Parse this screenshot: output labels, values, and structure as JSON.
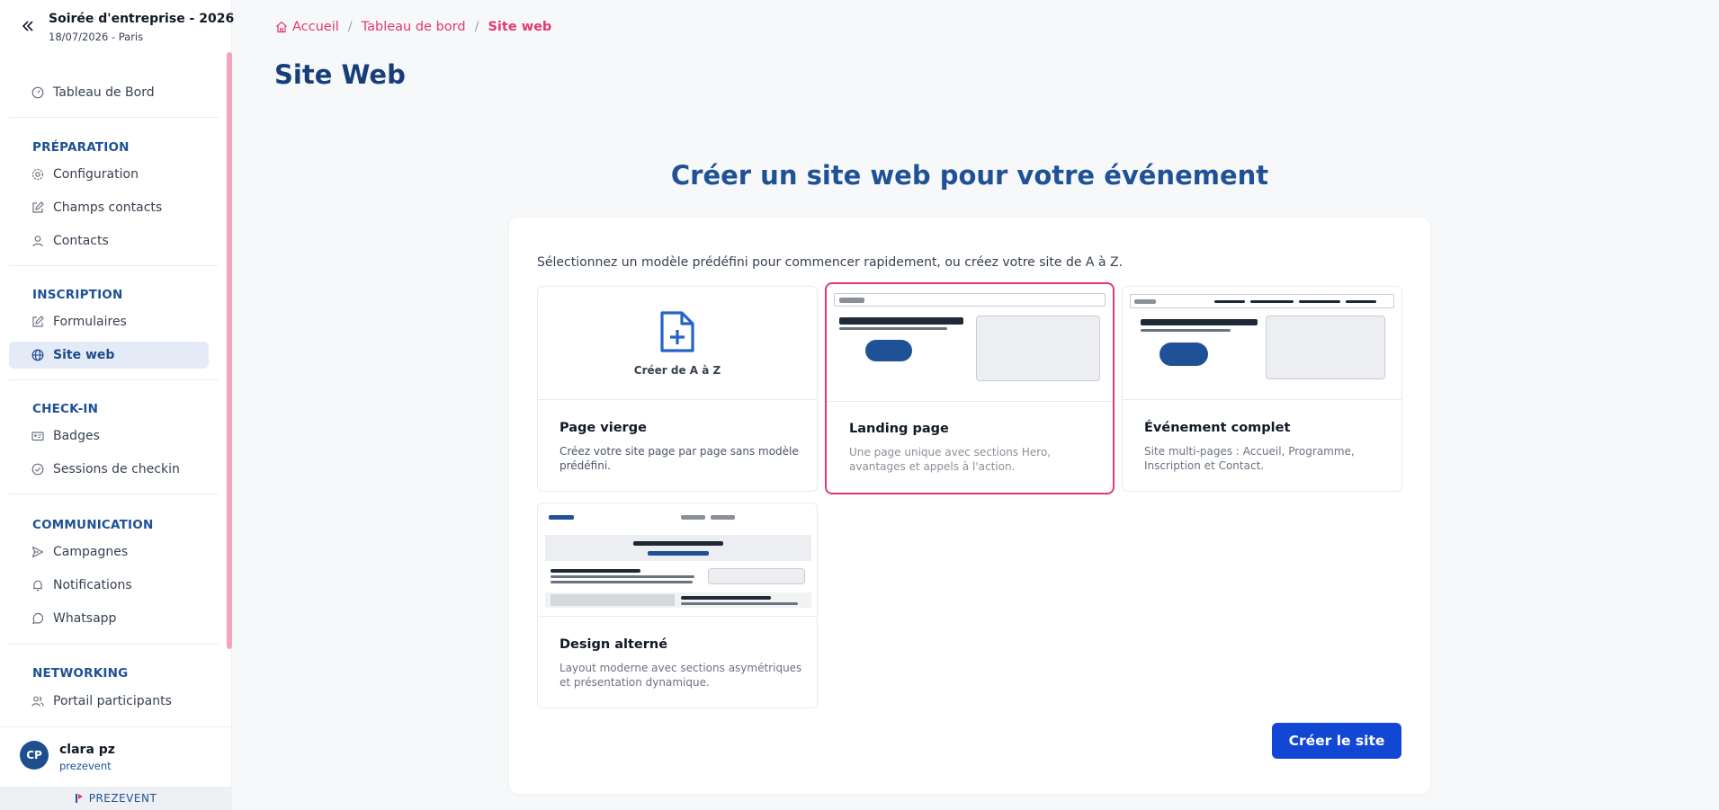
{
  "sidebar": {
    "event_title": "Soirée d'entreprise - 2026",
    "event_subtitle": "18/07/2026 - Paris",
    "dashboard": "Tableau de Bord",
    "sections": {
      "preparation": "PRÉPARATION",
      "inscription": "INSCRIPTION",
      "checkin": "CHECK-IN",
      "communication": "COMMUNICATION",
      "networking": "NETWORKING"
    },
    "items": {
      "configuration": "Configuration",
      "champs_contacts": "Champs contacts",
      "contacts": "Contacts",
      "formulaires": "Formulaires",
      "site_web": "Site web",
      "badges": "Badges",
      "sessions_checkin": "Sessions de checkin",
      "campagnes": "Campagnes",
      "notifications": "Notifications",
      "whatsapp": "Whatsapp",
      "portail_participants": "Portail participants"
    },
    "user": {
      "initials": "CP",
      "name": "clara pz",
      "org": "prezevent"
    },
    "brand": "PREZEVENT"
  },
  "breadcrumb": {
    "home": "Accueil",
    "dashboard": "Tableau de bord",
    "current": "Site web"
  },
  "page_title": "Site Web",
  "hero_title": "Créer un site web pour votre événement",
  "intro": "Sélectionnez un modèle prédéfini pour commencer rapidement, ou créez votre site de A à Z.",
  "templates": [
    {
      "name": "Page vierge",
      "description": "Créez votre site page par page sans modèle prédéfini.",
      "preview_label": "Créer de A à Z"
    },
    {
      "name": "Landing page",
      "description": "Une page unique avec sections Hero, avantages et appels à l'action.",
      "selected": true
    },
    {
      "name": "Événement complet",
      "description": "Site multi-pages : Accueil, Programme, Inscription et Contact."
    },
    {
      "name": "Design alterné",
      "description": "Layout moderne avec sections asymétriques et présentation dynamique."
    }
  ],
  "create_button": "Créer le site",
  "colors": {
    "accent": "#e3396e",
    "primary": "#1e5196",
    "button": "#1247d6"
  }
}
